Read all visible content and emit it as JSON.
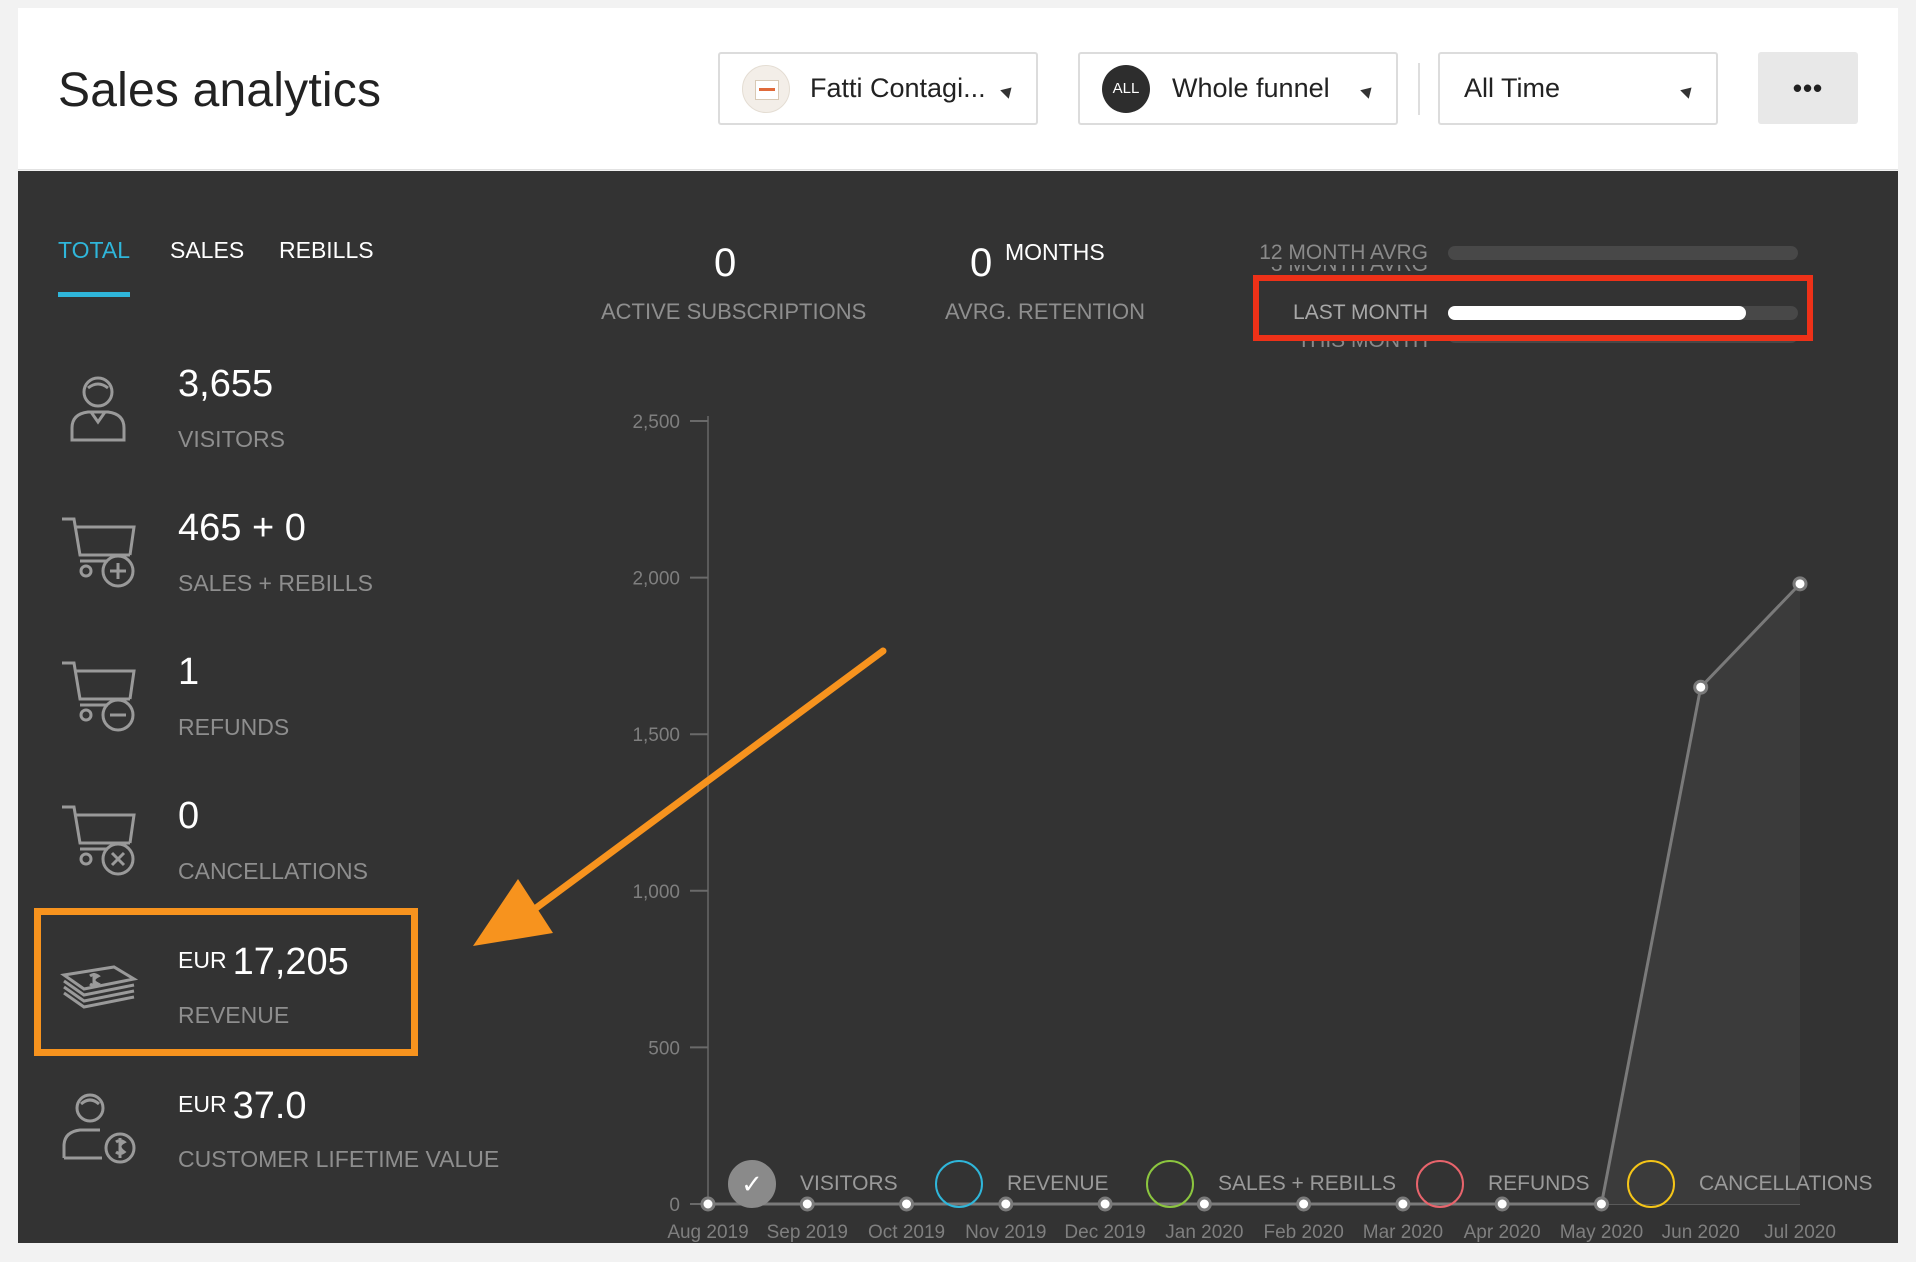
{
  "header": {
    "title": "Sales analytics",
    "product_dropdown": "Fatti Contagi...",
    "funnel_badge": "ALL",
    "funnel_dropdown": "Whole funnel",
    "time_dropdown": "All Time",
    "more_button": "•••"
  },
  "tabs": [
    {
      "label": "TOTAL",
      "active": true
    },
    {
      "label": "SALES",
      "active": false
    },
    {
      "label": "REBILLS",
      "active": false
    }
  ],
  "metrics": [
    {
      "icon": "visitor-icon",
      "value": "3,655",
      "label": "VISITORS"
    },
    {
      "icon": "cart-plus-icon",
      "value": "465 + 0",
      "label": "SALES + REBILLS"
    },
    {
      "icon": "cart-minus-icon",
      "value": "1",
      "label": "REFUNDS"
    },
    {
      "icon": "cart-x-icon",
      "value": "0",
      "label": "CANCELLATIONS"
    },
    {
      "icon": "money-stack-icon",
      "currency": "EUR",
      "value": "17,205",
      "label": "REVENUE"
    },
    {
      "icon": "customer-value-icon",
      "currency": "EUR",
      "value": "37.0",
      "label": "CUSTOMER LIFETIME VALUE"
    }
  ],
  "stats": {
    "active_subscriptions_value": "0",
    "active_subscriptions_label": "ACTIVE SUBSCRIPTIONS",
    "retention_value": "0",
    "retention_unit": "MONTHS",
    "retention_label": "AVRG. RETENTION"
  },
  "averages": [
    {
      "label": "12 MONTH AVRG",
      "fill": 0.0
    },
    {
      "label": "3 MONTH AVRG",
      "fill": 0.0
    },
    {
      "label": "LAST MONTH",
      "fill": 0.85
    },
    {
      "label": "THIS MONTH",
      "fill": 0.0
    }
  ],
  "colors": {
    "accent": "#2fb6da",
    "highlight_red": "#ee3118",
    "highlight_orange": "#f7931e",
    "panel_bg": "#333333"
  },
  "chart_data": {
    "type": "line",
    "categories": [
      "Aug 2019",
      "Sep 2019",
      "Oct 2019",
      "Nov 2019",
      "Dec 2019",
      "Jan 2020",
      "Feb 2020",
      "Mar 2020",
      "Apr 2020",
      "May 2020",
      "Jun 2020",
      "Jul 2020"
    ],
    "series": [
      {
        "name": "VISITORS",
        "values": [
          0,
          0,
          0,
          0,
          0,
          0,
          0,
          0,
          0,
          0,
          1650,
          1980
        ]
      }
    ],
    "yticks": [
      "0",
      "500",
      "1,000",
      "1,500",
      "2,000",
      "2,500"
    ],
    "ylim": [
      0,
      2500
    ],
    "grid": false
  },
  "legend": [
    {
      "label": "VISITORS",
      "color": "#8a8a8a",
      "checked": true
    },
    {
      "label": "REVENUE",
      "color": "#2fb6da",
      "checked": false
    },
    {
      "label": "SALES + REBILLS",
      "color": "#8cc63f",
      "checked": false
    },
    {
      "label": "REFUNDS",
      "color": "#e8646c",
      "checked": false
    },
    {
      "label": "CANCELLATIONS",
      "color": "#f5c518",
      "checked": false
    }
  ]
}
